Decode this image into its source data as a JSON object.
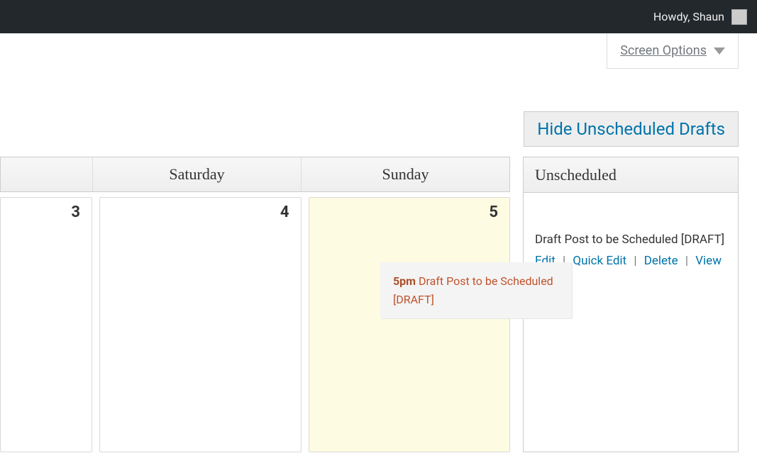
{
  "admin_bar": {
    "greeting": "Howdy, Shaun"
  },
  "screen_options": {
    "label": "Screen Options"
  },
  "actions": {
    "hide_drafts_label": "Hide Unscheduled Drafts"
  },
  "calendar": {
    "day_headers": [
      "Saturday",
      "Sunday"
    ],
    "cells": [
      {
        "date": "3",
        "today": false
      },
      {
        "date": "4",
        "today": false
      },
      {
        "date": "5",
        "today": true
      }
    ],
    "event": {
      "time": "5pm",
      "title": "Draft Post to be Scheduled [DRAFT]"
    }
  },
  "sidebar": {
    "title": "Unscheduled",
    "draft": {
      "title": "Draft Post to be Scheduled [DRAFT]",
      "actions": {
        "edit": "Edit",
        "quick_edit": "Quick Edit",
        "delete": "Delete",
        "view": "View"
      }
    }
  }
}
